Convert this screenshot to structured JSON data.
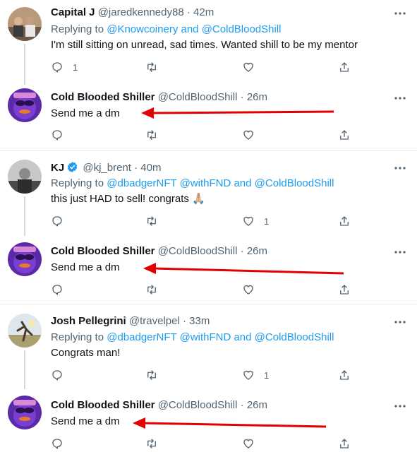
{
  "colors": {
    "link": "#1d9bf0",
    "text": "#0f1419",
    "muted": "#536471",
    "arrow": "#e30000",
    "avatar_purple": "#5a2aa8"
  },
  "tweets": [
    {
      "name": "Capital J",
      "handle": "@jaredkennedy88",
      "time": "42m",
      "reply_prefix": "Replying to ",
      "reply_handles": [
        "@Knowcoinery",
        "@ColdBloodShill"
      ],
      "reply_joins": [
        " and "
      ],
      "text": "I'm still sitting on unread, sad times. Wanted shill to be my mentor",
      "reply_count": "1",
      "like_count": "",
      "verified": false,
      "avatar": "group-photo"
    },
    {
      "name": "Cold Blooded Shiller",
      "handle": "@ColdBloodShill",
      "time": "26m",
      "text": "Send me a dm",
      "reply_count": "",
      "like_count": "",
      "avatar": "purple-character"
    },
    {
      "name": "KJ",
      "handle": "@kj_brent",
      "time": "40m",
      "reply_prefix": "Replying to ",
      "reply_handles": [
        "@dbadgerNFT",
        "@withFND",
        "@ColdBloodShill"
      ],
      "reply_joins": [
        " ",
        " and "
      ],
      "text": "this just HAD to sell! congrats 🙏🏼",
      "reply_count": "",
      "like_count": "1",
      "verified": true,
      "avatar": "bw-photo"
    },
    {
      "name": "Cold Blooded Shiller",
      "handle": "@ColdBloodShill",
      "time": "26m",
      "text": "Send me a dm",
      "reply_count": "",
      "like_count": "",
      "avatar": "purple-character"
    },
    {
      "name": "Josh Pellegrini",
      "handle": "@travelpel",
      "time": "33m",
      "reply_prefix": "Replying to ",
      "reply_handles": [
        "@dbadgerNFT",
        "@withFND",
        "@ColdBloodShill"
      ],
      "reply_joins": [
        " ",
        " and "
      ],
      "text": "Congrats man!",
      "reply_count": "",
      "like_count": "1",
      "verified": false,
      "avatar": "outdoor-photo"
    },
    {
      "name": "Cold Blooded Shiller",
      "handle": "@ColdBloodShill",
      "time": "26m",
      "text": "Send me a dm",
      "reply_count": "",
      "like_count": "",
      "avatar": "purple-character"
    }
  ]
}
